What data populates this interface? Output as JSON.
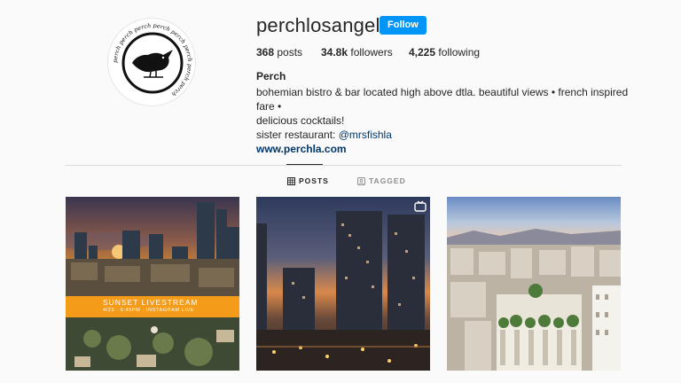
{
  "profile": {
    "username": "perchlosangeles",
    "follow_label": "Follow",
    "avatar_ring_text": "perch perch perch perch perch perch perch perch",
    "stats": {
      "posts_count": "368",
      "posts_label": "posts",
      "followers_count": "34.8k",
      "followers_label": "followers",
      "following_count": "4,225",
      "following_label": "following"
    },
    "bio": {
      "name": "Perch",
      "line1": "bohemian bistro & bar located high above dtla. beautiful views • french inspired fare •",
      "line2": "delicious cocktails!",
      "sister_prefix": "sister restaurant: ",
      "sister_mention": "@mrsfishla",
      "website": "www.perchla.com"
    }
  },
  "tabs": {
    "posts": "POSTS",
    "tagged": "TAGGED",
    "active": "posts"
  },
  "posts": [
    {
      "banner_title": "SUNSET LIVESTREAM",
      "banner_sub": "4/23 · 6:45PM · INSTAGRAM LIVE"
    },
    {
      "icon": "igtv-icon"
    },
    {}
  ],
  "colors": {
    "accent": "#0095f6",
    "link": "#00376b",
    "banner": "#f49b1a",
    "text": "#262626",
    "muted": "#8e8e8e"
  }
}
